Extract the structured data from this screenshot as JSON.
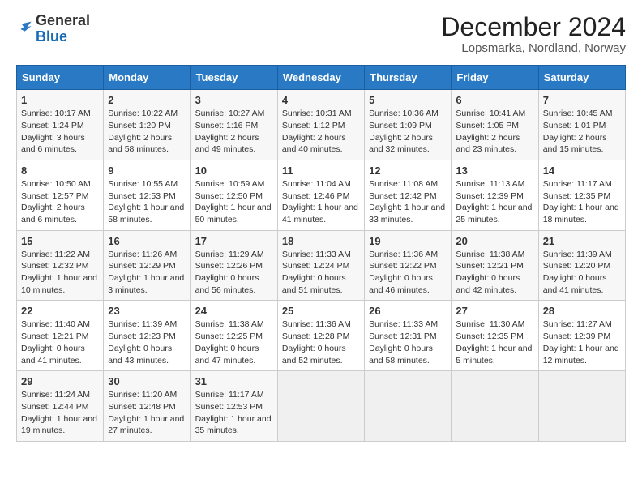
{
  "header": {
    "logo_general": "General",
    "logo_blue": "Blue",
    "month_title": "December 2024",
    "location": "Lopsmarka, Nordland, Norway"
  },
  "days_of_week": [
    "Sunday",
    "Monday",
    "Tuesday",
    "Wednesday",
    "Thursday",
    "Friday",
    "Saturday"
  ],
  "weeks": [
    [
      {
        "day": "1",
        "info": "Sunrise: 10:17 AM\nSunset: 1:24 PM\nDaylight: 3 hours and 6 minutes."
      },
      {
        "day": "2",
        "info": "Sunrise: 10:22 AM\nSunset: 1:20 PM\nDaylight: 2 hours and 58 minutes."
      },
      {
        "day": "3",
        "info": "Sunrise: 10:27 AM\nSunset: 1:16 PM\nDaylight: 2 hours and 49 minutes."
      },
      {
        "day": "4",
        "info": "Sunrise: 10:31 AM\nSunset: 1:12 PM\nDaylight: 2 hours and 40 minutes."
      },
      {
        "day": "5",
        "info": "Sunrise: 10:36 AM\nSunset: 1:09 PM\nDaylight: 2 hours and 32 minutes."
      },
      {
        "day": "6",
        "info": "Sunrise: 10:41 AM\nSunset: 1:05 PM\nDaylight: 2 hours and 23 minutes."
      },
      {
        "day": "7",
        "info": "Sunrise: 10:45 AM\nSunset: 1:01 PM\nDaylight: 2 hours and 15 minutes."
      }
    ],
    [
      {
        "day": "8",
        "info": "Sunrise: 10:50 AM\nSunset: 12:57 PM\nDaylight: 2 hours and 6 minutes."
      },
      {
        "day": "9",
        "info": "Sunrise: 10:55 AM\nSunset: 12:53 PM\nDaylight: 1 hour and 58 minutes."
      },
      {
        "day": "10",
        "info": "Sunrise: 10:59 AM\nSunset: 12:50 PM\nDaylight: 1 hour and 50 minutes."
      },
      {
        "day": "11",
        "info": "Sunrise: 11:04 AM\nSunset: 12:46 PM\nDaylight: 1 hour and 41 minutes."
      },
      {
        "day": "12",
        "info": "Sunrise: 11:08 AM\nSunset: 12:42 PM\nDaylight: 1 hour and 33 minutes."
      },
      {
        "day": "13",
        "info": "Sunrise: 11:13 AM\nSunset: 12:39 PM\nDaylight: 1 hour and 25 minutes."
      },
      {
        "day": "14",
        "info": "Sunrise: 11:17 AM\nSunset: 12:35 PM\nDaylight: 1 hour and 18 minutes."
      }
    ],
    [
      {
        "day": "15",
        "info": "Sunrise: 11:22 AM\nSunset: 12:32 PM\nDaylight: 1 hour and 10 minutes."
      },
      {
        "day": "16",
        "info": "Sunrise: 11:26 AM\nSunset: 12:29 PM\nDaylight: 1 hour and 3 minutes."
      },
      {
        "day": "17",
        "info": "Sunrise: 11:29 AM\nSunset: 12:26 PM\nDaylight: 0 hours and 56 minutes."
      },
      {
        "day": "18",
        "info": "Sunrise: 11:33 AM\nSunset: 12:24 PM\nDaylight: 0 hours and 51 minutes."
      },
      {
        "day": "19",
        "info": "Sunrise: 11:36 AM\nSunset: 12:22 PM\nDaylight: 0 hours and 46 minutes."
      },
      {
        "day": "20",
        "info": "Sunrise: 11:38 AM\nSunset: 12:21 PM\nDaylight: 0 hours and 42 minutes."
      },
      {
        "day": "21",
        "info": "Sunrise: 11:39 AM\nSunset: 12:20 PM\nDaylight: 0 hours and 41 minutes."
      }
    ],
    [
      {
        "day": "22",
        "info": "Sunrise: 11:40 AM\nSunset: 12:21 PM\nDaylight: 0 hours and 41 minutes."
      },
      {
        "day": "23",
        "info": "Sunrise: 11:39 AM\nSunset: 12:23 PM\nDaylight: 0 hours and 43 minutes."
      },
      {
        "day": "24",
        "info": "Sunrise: 11:38 AM\nSunset: 12:25 PM\nDaylight: 0 hours and 47 minutes."
      },
      {
        "day": "25",
        "info": "Sunrise: 11:36 AM\nSunset: 12:28 PM\nDaylight: 0 hours and 52 minutes."
      },
      {
        "day": "26",
        "info": "Sunrise: 11:33 AM\nSunset: 12:31 PM\nDaylight: 0 hours and 58 minutes."
      },
      {
        "day": "27",
        "info": "Sunrise: 11:30 AM\nSunset: 12:35 PM\nDaylight: 1 hour and 5 minutes."
      },
      {
        "day": "28",
        "info": "Sunrise: 11:27 AM\nSunset: 12:39 PM\nDaylight: 1 hour and 12 minutes."
      }
    ],
    [
      {
        "day": "29",
        "info": "Sunrise: 11:24 AM\nSunset: 12:44 PM\nDaylight: 1 hour and 19 minutes."
      },
      {
        "day": "30",
        "info": "Sunrise: 11:20 AM\nSunset: 12:48 PM\nDaylight: 1 hour and 27 minutes."
      },
      {
        "day": "31",
        "info": "Sunrise: 11:17 AM\nSunset: 12:53 PM\nDaylight: 1 hour and 35 minutes."
      },
      {
        "day": "",
        "info": ""
      },
      {
        "day": "",
        "info": ""
      },
      {
        "day": "",
        "info": ""
      },
      {
        "day": "",
        "info": ""
      }
    ]
  ]
}
